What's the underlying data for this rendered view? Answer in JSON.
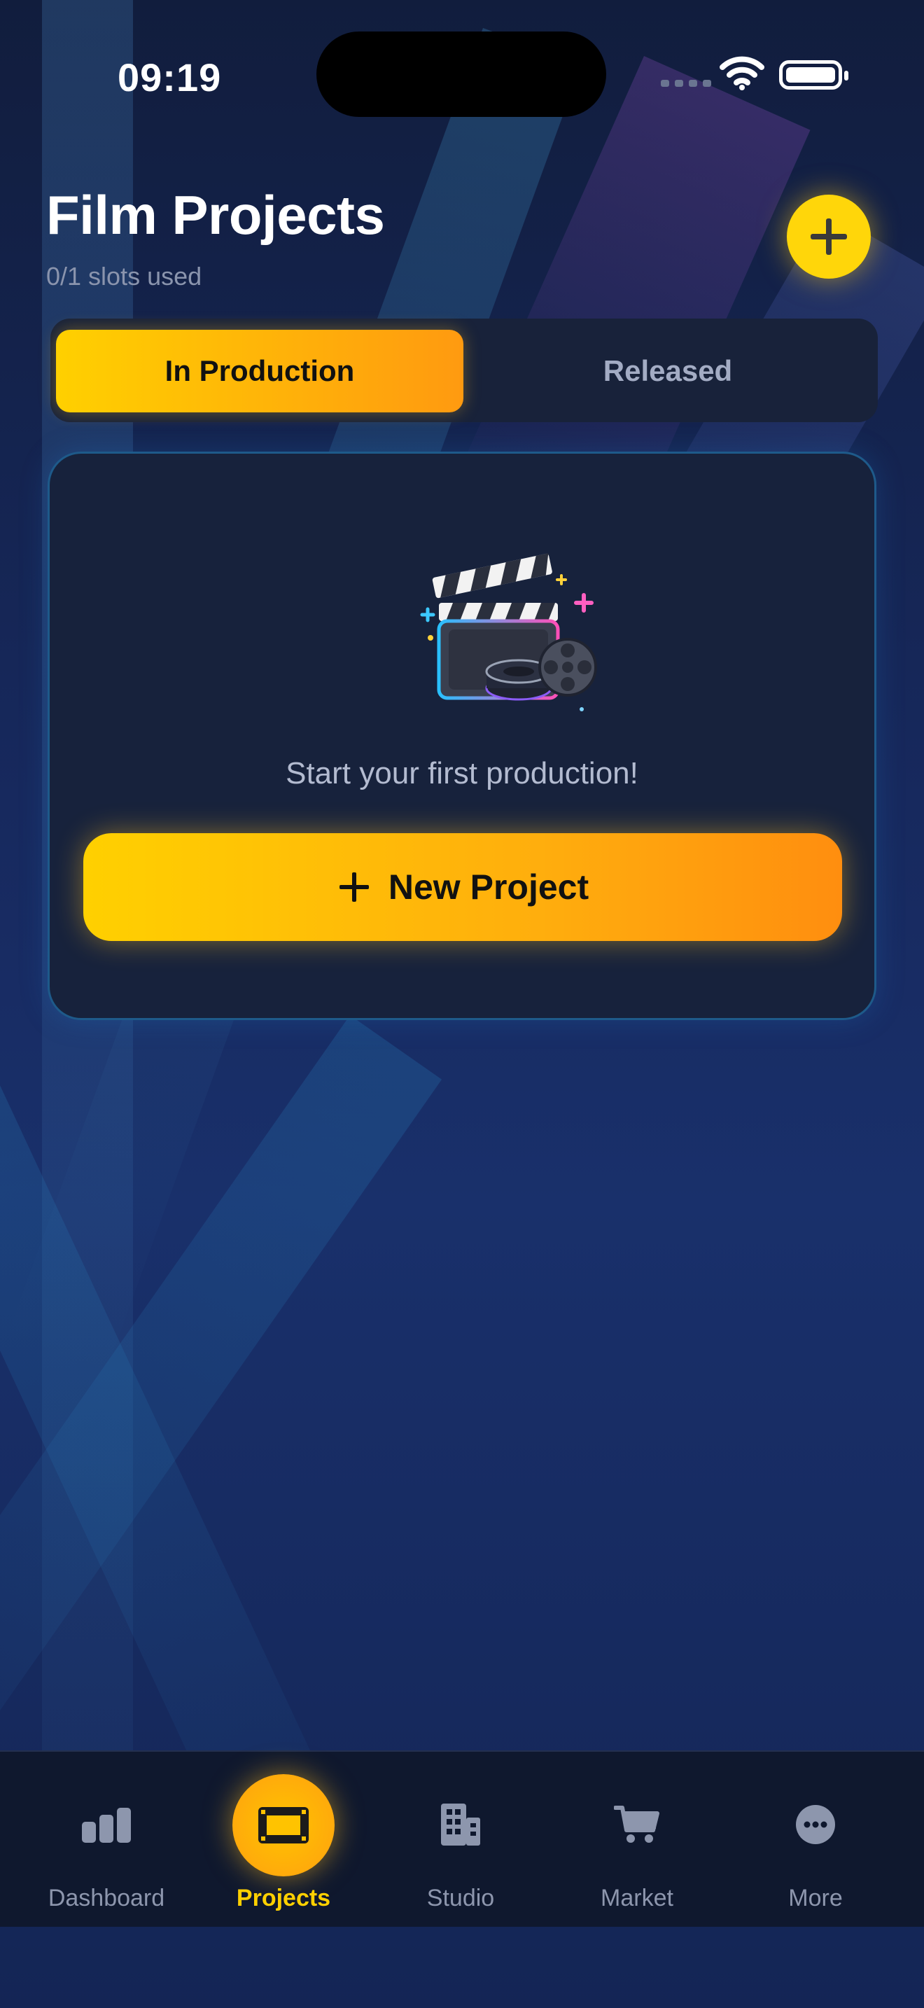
{
  "status_bar": {
    "time": "09:19"
  },
  "header": {
    "title": "Film Projects",
    "slots": "0/1 slots used"
  },
  "tabs": [
    {
      "label": "In Production",
      "active": true
    },
    {
      "label": "Released",
      "active": false
    }
  ],
  "empty_state": {
    "message": "Start your first production!",
    "button_label": "New Project",
    "illustration": "clapperboard-icon"
  },
  "bottom_nav": [
    {
      "label": "Dashboard",
      "icon": "bar-chart-icon",
      "active": false
    },
    {
      "label": "Projects",
      "icon": "film-icon",
      "active": true
    },
    {
      "label": "Studio",
      "icon": "building-icon",
      "active": false
    },
    {
      "label": "Market",
      "icon": "cart-icon",
      "active": false
    },
    {
      "label": "More",
      "icon": "more-icon",
      "active": false
    }
  ],
  "colors": {
    "accent": "#ffd000",
    "accent_end": "#ff9a10",
    "background": "#17295e",
    "card": "#17223c",
    "nav": "#0f182e"
  }
}
